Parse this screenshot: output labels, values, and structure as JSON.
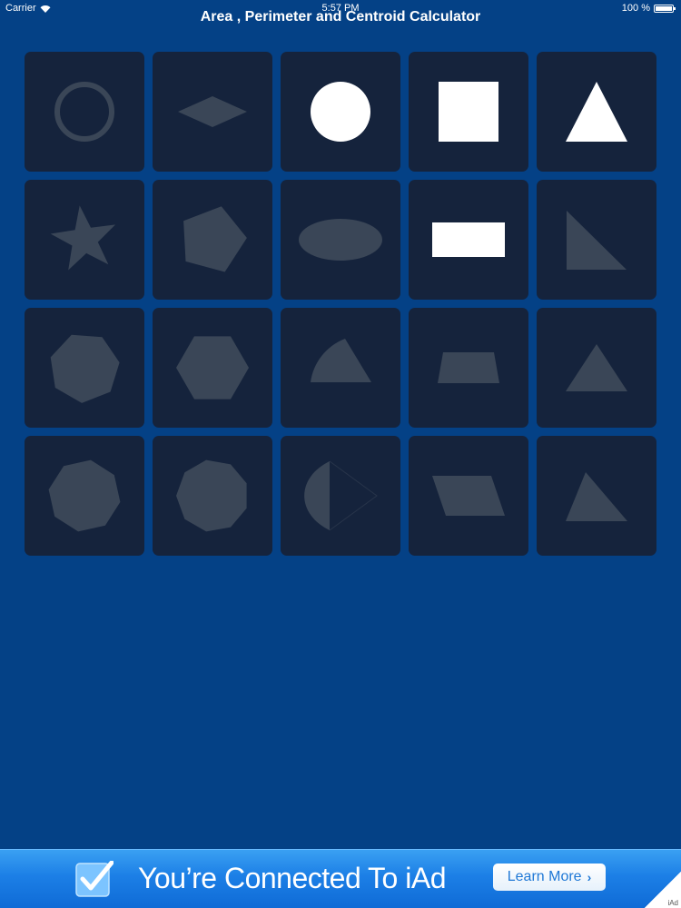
{
  "status_bar": {
    "carrier": "Carrier",
    "time": "5:57 PM",
    "battery": "100 %"
  },
  "header": {
    "title": "Area , Perimeter and Centroid Calculator"
  },
  "colors": {
    "background": "#044186",
    "tile": "#15233c",
    "shape_active": "#ffffff",
    "shape_inactive": "#3a4657",
    "ad_blue": "#1c7fe6"
  },
  "shapes": [
    {
      "name": "annulus",
      "icon": "annulus-icon",
      "active": false
    },
    {
      "name": "rhombus",
      "icon": "rhombus-icon",
      "active": false
    },
    {
      "name": "circle",
      "icon": "circle-icon",
      "active": true
    },
    {
      "name": "square",
      "icon": "square-icon",
      "active": true
    },
    {
      "name": "triangle",
      "icon": "triangle-icon",
      "active": true
    },
    {
      "name": "star",
      "icon": "star-icon",
      "active": false
    },
    {
      "name": "pentagon",
      "icon": "pentagon-icon",
      "active": false
    },
    {
      "name": "ellipse",
      "icon": "ellipse-icon",
      "active": false
    },
    {
      "name": "rectangle",
      "icon": "rectangle-icon",
      "active": true
    },
    {
      "name": "right-triangle",
      "icon": "right-triangle-icon",
      "active": false
    },
    {
      "name": "heptagon",
      "icon": "heptagon-icon",
      "active": false
    },
    {
      "name": "hexagon",
      "icon": "hexagon-icon",
      "active": false
    },
    {
      "name": "circular-sector",
      "icon": "sector-icon",
      "active": false
    },
    {
      "name": "trapezoid",
      "icon": "trapezoid-icon",
      "active": false
    },
    {
      "name": "isosceles-triangle",
      "icon": "isosceles-triangle-icon",
      "active": false
    },
    {
      "name": "octagon",
      "icon": "octagon-icon",
      "active": false
    },
    {
      "name": "nonagon",
      "icon": "nonagon-icon",
      "active": false
    },
    {
      "name": "circular-segment",
      "icon": "segment-icon",
      "active": false
    },
    {
      "name": "parallelogram",
      "icon": "parallelogram-icon",
      "active": false
    },
    {
      "name": "scalene-triangle",
      "icon": "scalene-triangle-icon",
      "active": false
    }
  ],
  "ad": {
    "text": "You’re Connected To iAd",
    "button_label": "Learn More",
    "corner_label": "iAd"
  }
}
